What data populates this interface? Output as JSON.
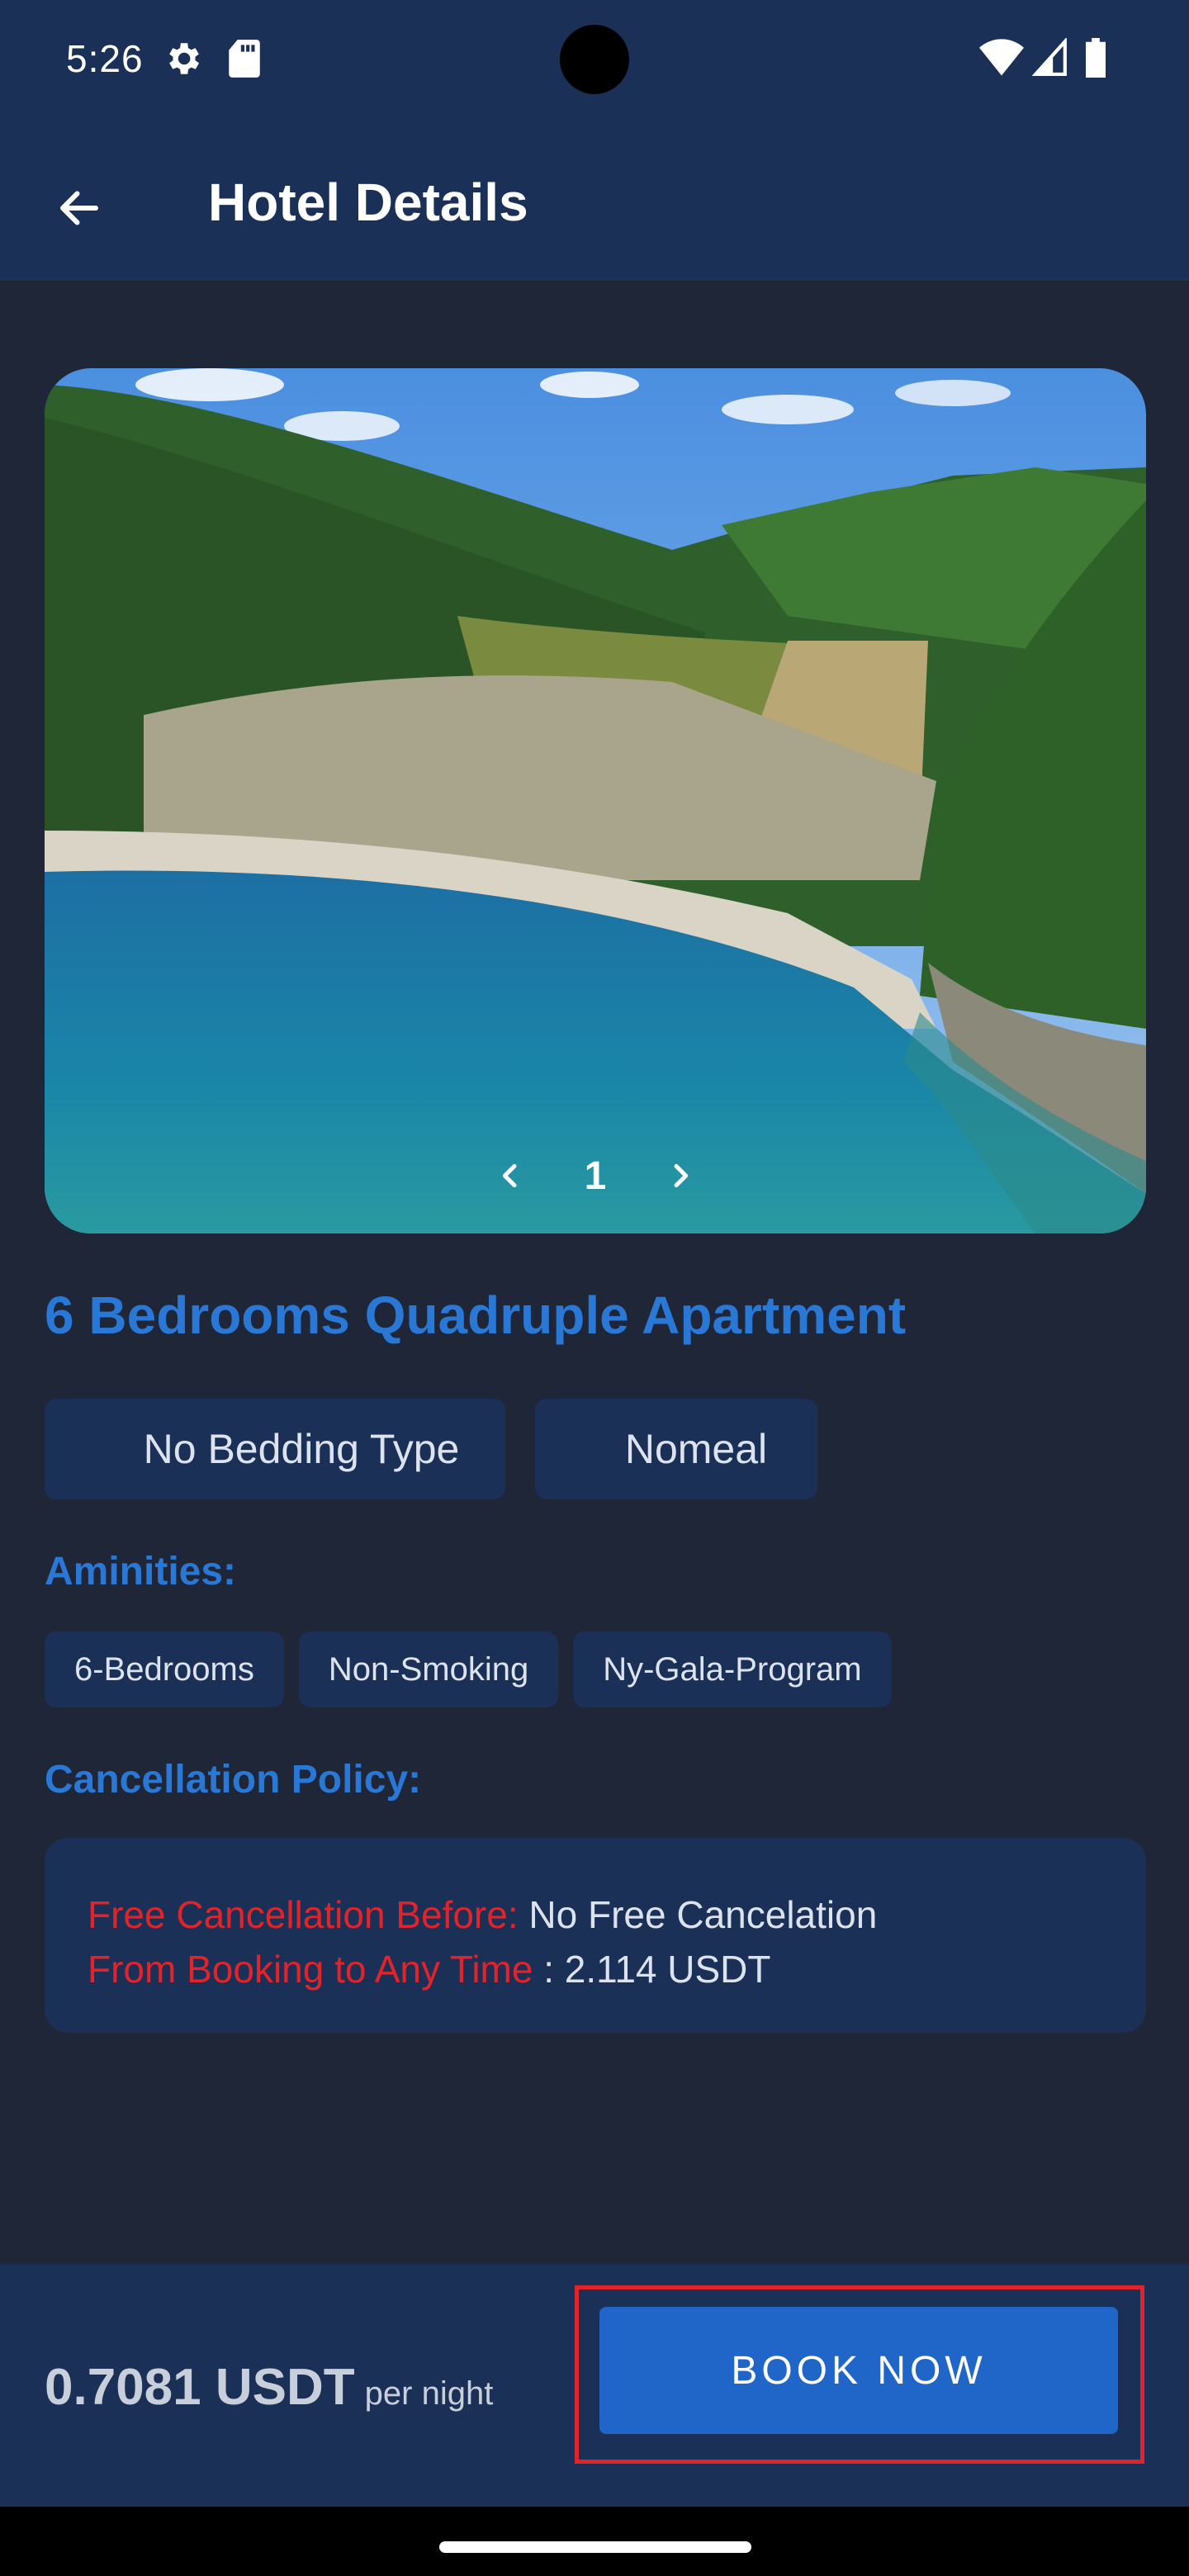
{
  "status_bar": {
    "time": "5:26",
    "icons": [
      "settings-gear-icon",
      "sd-card-icon",
      "wifi-icon",
      "cellular-signal-icon",
      "battery-icon"
    ]
  },
  "app_bar": {
    "title": "Hotel Details",
    "back_icon": "arrow-left-icon"
  },
  "hero": {
    "image_description_icon": "hotel-photo",
    "current_index": "1",
    "prev_icon": "chevron-left-icon",
    "next_icon": "chevron-right-icon"
  },
  "room": {
    "title": "6 Bedrooms Quadruple Apartment",
    "bedding": "No Bedding Type",
    "meal": "Nomeal"
  },
  "amenities": {
    "label": "Aminities:",
    "items": [
      "6-Bedrooms",
      "Non-Smoking",
      "Ny-Gala-Program"
    ]
  },
  "cancellation": {
    "label": "Cancellation Policy:",
    "free_before_key": "Free Cancellation Before:",
    "free_before_value": " No Free Cancelation",
    "booking_key": "From Booking to Any Time",
    "booking_value": " : 2.114 USDT"
  },
  "footer": {
    "price": "0.7081 USDT",
    "price_unit": "per night",
    "book_label": "BOOK NOW"
  },
  "colors": {
    "background": "#1e2638",
    "panel": "#1b3056",
    "accent_blue": "#2a78d6",
    "button_blue": "#1f66c8",
    "alert_red": "#e3232a"
  }
}
